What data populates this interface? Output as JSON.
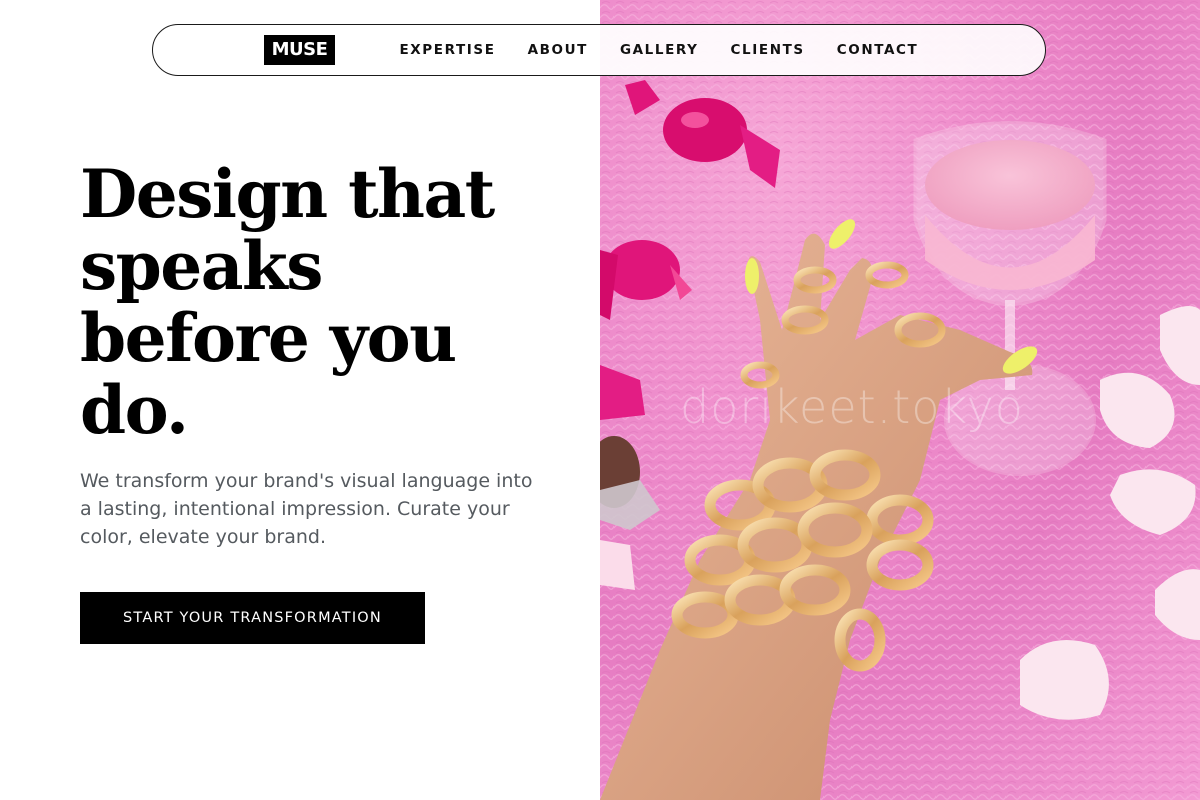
{
  "nav": {
    "logo": "MUSE",
    "links": [
      "EXPERTISE",
      "ABOUT",
      "GALLERY",
      "CLIENTS",
      "CONTACT"
    ]
  },
  "hero": {
    "headline": "Design that speaks before you do.",
    "subtext": "We transform your brand's visual language into a lasting, intentional impression. Curate your color, elevate your brand.",
    "cta_label": "START YOUR TRANSFORMATION",
    "image_watermark": "dorikeet.tokyo"
  },
  "colors": {
    "accent": "#000000",
    "text_muted": "#555a5f",
    "photo_background": "#ee8ccb"
  },
  "icons": {
    "hero_image": "hand-with-gold-jewelry-and-pink-cocktail"
  }
}
